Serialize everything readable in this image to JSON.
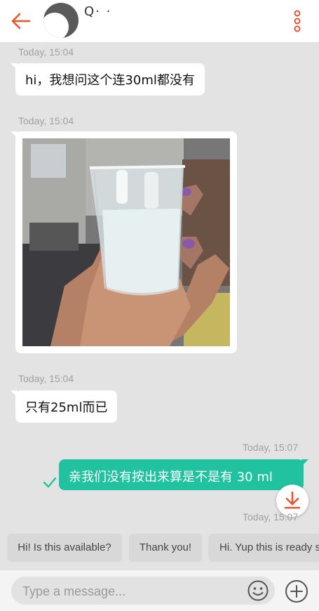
{
  "header": {
    "contact_name": "Q· ·",
    "back_icon": "arrow-left-icon",
    "menu_icon": "more-vertical-icon",
    "accent_color": "#e8542b"
  },
  "messages": [
    {
      "direction": "in",
      "timestamp": "Today, 15:04",
      "text": "hi，我想问这个连30ml都没有"
    },
    {
      "direction": "in",
      "timestamp": "Today, 15:04",
      "type": "image",
      "description": "hand holding small glass beaker with white liquid"
    },
    {
      "direction": "in",
      "timestamp": "Today, 15:04",
      "text": "只有25ml而已"
    },
    {
      "direction": "out",
      "timestamp": "Today, 15:07",
      "text": "亲我们没有按出来算是不是有 30 ml"
    },
    {
      "direction": "out",
      "timestamp": "Today, 15:07"
    }
  ],
  "quick_replies": [
    "Hi! Is this available?",
    "Thank you!",
    "Hi. Yup this is ready s"
  ],
  "composer": {
    "placeholder": "Type a message...",
    "emoji_icon": "smiley-icon",
    "add_icon": "plus-circle-icon"
  },
  "colors": {
    "background": "#e3e3e3",
    "outgoing_bubble": "#21c2a0",
    "incoming_bubble": "#ffffff"
  }
}
